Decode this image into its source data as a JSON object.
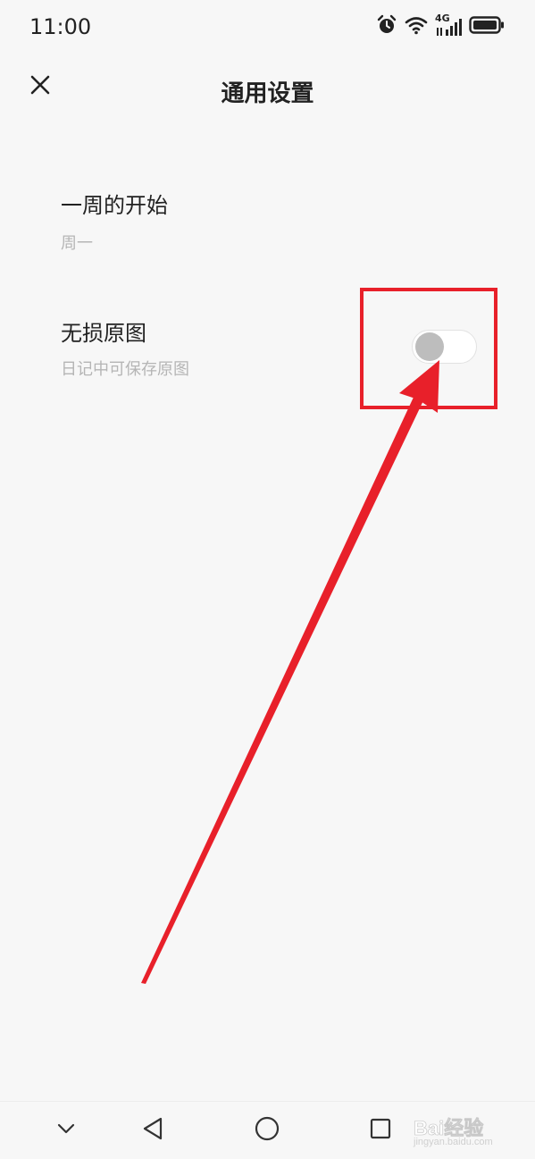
{
  "status_bar": {
    "time": "11:00",
    "network_label": "4G",
    "icons": [
      "alarm-icon",
      "wifi-icon",
      "signal-icon",
      "battery-icon"
    ]
  },
  "app_bar": {
    "close_icon": "close-icon",
    "title": "通用设置"
  },
  "settings": {
    "week_start": {
      "title": "一周的开始",
      "value": "周一"
    },
    "lossless_image": {
      "title": "无损原图",
      "description": "日记中可保存原图",
      "enabled": false
    }
  },
  "annotation": {
    "color": "#e8202a"
  },
  "nav_bar": {
    "icons": [
      "chevron-down-icon",
      "back-triangle-icon",
      "home-circle-icon",
      "recents-square-icon"
    ]
  },
  "watermark": {
    "text": "Bai经验",
    "url": "jingyan.baidu.com"
  }
}
